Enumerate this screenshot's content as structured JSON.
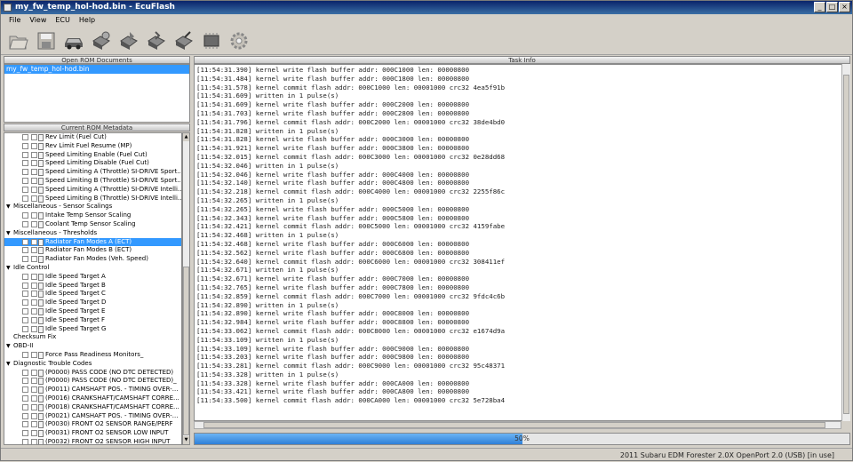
{
  "window": {
    "title": "my_fw_temp_hol-hod.bin - EcuFlash"
  },
  "menu": [
    "File",
    "View",
    "ECU",
    "Help"
  ],
  "toolbar_icons": [
    "open-folder-icon",
    "save-disk-icon",
    "car-icon",
    "read-ecu-icon",
    "write-ecu-icon",
    "compare-icon",
    "test-write-icon",
    "chip-icon",
    "settings-gear-icon"
  ],
  "panes": {
    "docs_header": "Open ROM Documents",
    "meta_header": "Current ROM Metadata",
    "task_header": "Task Info"
  },
  "docs": [
    "my_fw_temp_hol-hod.bin"
  ],
  "tree": [
    {
      "t": "Rev Limit (Fuel Cut)"
    },
    {
      "t": "Rev Limit Fuel Resume (MP)"
    },
    {
      "t": "Speed Limiting Enable (Fuel Cut)"
    },
    {
      "t": "Speed Limiting Disable (Fuel Cut)"
    },
    {
      "t": "Speed Limiting A (Throttle) SI-DRIVE Sport..."
    },
    {
      "t": "Speed Limiting B (Throttle) SI-DRIVE Sport..."
    },
    {
      "t": "Speed Limiting A (Throttle) SI-DRIVE Intelli..."
    },
    {
      "t": "Speed Limiting B (Throttle) SI-DRIVE Intelli..."
    },
    {
      "t": "Miscellaneous - Sensor Scalings",
      "cat": true
    },
    {
      "t": "Intake Temp Sensor Scaling"
    },
    {
      "t": "Coolant Temp Sensor Scaling"
    },
    {
      "t": "Miscellaneous - Thresholds",
      "cat": true
    },
    {
      "t": "Radiator Fan Modes A (ECT)",
      "sel": true
    },
    {
      "t": "Radiator Fan Modes B (ECT)"
    },
    {
      "t": "Radiator Fan Modes (Veh. Speed)"
    },
    {
      "t": "Idle Control",
      "cat": true
    },
    {
      "t": "Idle Speed Target A"
    },
    {
      "t": "Idle Speed Target B"
    },
    {
      "t": "Idle Speed Target C"
    },
    {
      "t": "Idle Speed Target D"
    },
    {
      "t": "Idle Speed Target E"
    },
    {
      "t": "Idle Speed Target F"
    },
    {
      "t": "Idle Speed Target G"
    },
    {
      "t": "Checksum Fix",
      "cat": true,
      "noexp": true
    },
    {
      "t": "OBD-II",
      "cat": true
    },
    {
      "t": "Force Pass Readiness Monitors_"
    },
    {
      "t": "Diagnostic Trouble Codes",
      "cat": true
    },
    {
      "t": "(P0000) PASS CODE (NO DTC DETECTED)"
    },
    {
      "t": "(P0000) PASS CODE (NO DTC DETECTED)_"
    },
    {
      "t": "(P0011) CAMSHAFT POS. - TIMING OVER-..."
    },
    {
      "t": "(P0016) CRANKSHAFT/CAMSHAFT CORRE..."
    },
    {
      "t": "(P0018) CRANKSHAFT/CAMSHAFT CORRE..."
    },
    {
      "t": "(P0021) CAMSHAFT POS. - TIMING OVER-..."
    },
    {
      "t": "(P0030) FRONT O2 SENSOR RANGE/PERF"
    },
    {
      "t": "(P0031) FRONT O2 SENSOR LOW INPUT"
    },
    {
      "t": "(P0032) FRONT O2 SENSOR HIGH INPUT"
    }
  ],
  "log": [
    "[11:54:31.390] kernel write flash buffer addr: 000C1000 len: 00000800",
    "[11:54:31.484] kernel write flash buffer addr: 000C1800 len: 00000800",
    "[11:54:31.578] kernel commit flash addr: 000C1000 len: 00001000 crc32 4ea5f91b",
    "[11:54:31.609] written in 1 pulse(s)",
    "[11:54:31.609] kernel write flash buffer addr: 000C2000 len: 00000800",
    "[11:54:31.703] kernel write flash buffer addr: 000C2800 len: 00000800",
    "[11:54:31.796] kernel commit flash addr: 000C2000 len: 00001000 crc32 38de4bd0",
    "[11:54:31.828] written in 1 pulse(s)",
    "[11:54:31.828] kernel write flash buffer addr: 000C3000 len: 00000800",
    "[11:54:31.921] kernel write flash buffer addr: 000C3800 len: 00000800",
    "[11:54:32.015] kernel commit flash addr: 000C3000 len: 00001000 crc32 0e28dd68",
    "[11:54:32.046] written in 1 pulse(s)",
    "[11:54:32.046] kernel write flash buffer addr: 000C4000 len: 00000800",
    "[11:54:32.140] kernel write flash buffer addr: 000C4800 len: 00000800",
    "[11:54:32.218] kernel commit flash addr: 000C4000 len: 00001000 crc32 2255f86c",
    "[11:54:32.265] written in 1 pulse(s)",
    "[11:54:32.265] kernel write flash buffer addr: 000C5000 len: 00000800",
    "[11:54:32.343] kernel write flash buffer addr: 000C5800 len: 00000800",
    "[11:54:32.421] kernel commit flash addr: 000C5000 len: 00001000 crc32 4159fabe",
    "[11:54:32.468] written in 1 pulse(s)",
    "[11:54:32.468] kernel write flash buffer addr: 000C6000 len: 00000800",
    "[11:54:32.562] kernel write flash buffer addr: 000C6800 len: 00000800",
    "[11:54:32.640] kernel commit flash addr: 000C6000 len: 00001000 crc32 308411ef",
    "[11:54:32.671] written in 1 pulse(s)",
    "[11:54:32.671] kernel write flash buffer addr: 000C7000 len: 00000800",
    "[11:54:32.765] kernel write flash buffer addr: 000C7800 len: 00000800",
    "[11:54:32.859] kernel commit flash addr: 000C7000 len: 00001000 crc32 9fdc4c6b",
    "[11:54:32.890] written in 1 pulse(s)",
    "[11:54:32.890] kernel write flash buffer addr: 000C8000 len: 00000800",
    "[11:54:32.984] kernel write flash buffer addr: 000C8800 len: 00000800",
    "[11:54:33.062] kernel commit flash addr: 000C8000 len: 00001000 crc32 e1674d9a",
    "[11:54:33.109] written in 1 pulse(s)",
    "[11:54:33.109] kernel write flash buffer addr: 000C9000 len: 00000800",
    "[11:54:33.203] kernel write flash buffer addr: 000C9800 len: 00000800",
    "[11:54:33.281] kernel commit flash addr: 000C9000 len: 00001000 crc32 95c48371",
    "[11:54:33.328] written in 1 pulse(s)",
    "[11:54:33.328] kernel write flash buffer addr: 000CA000 len: 00000800",
    "[11:54:33.421] kernel write flash buffer addr: 000CA800 len: 00000800",
    "[11:54:33.500] kernel commit flash addr: 000CA000 len: 00001000 crc32 5e728ba4"
  ],
  "progress": {
    "value": 0.5,
    "label": "50%"
  },
  "status": {
    "text": "2011 Subaru EDM Forester 2.0X   OpenPort 2.0 (USB) [in use]"
  }
}
